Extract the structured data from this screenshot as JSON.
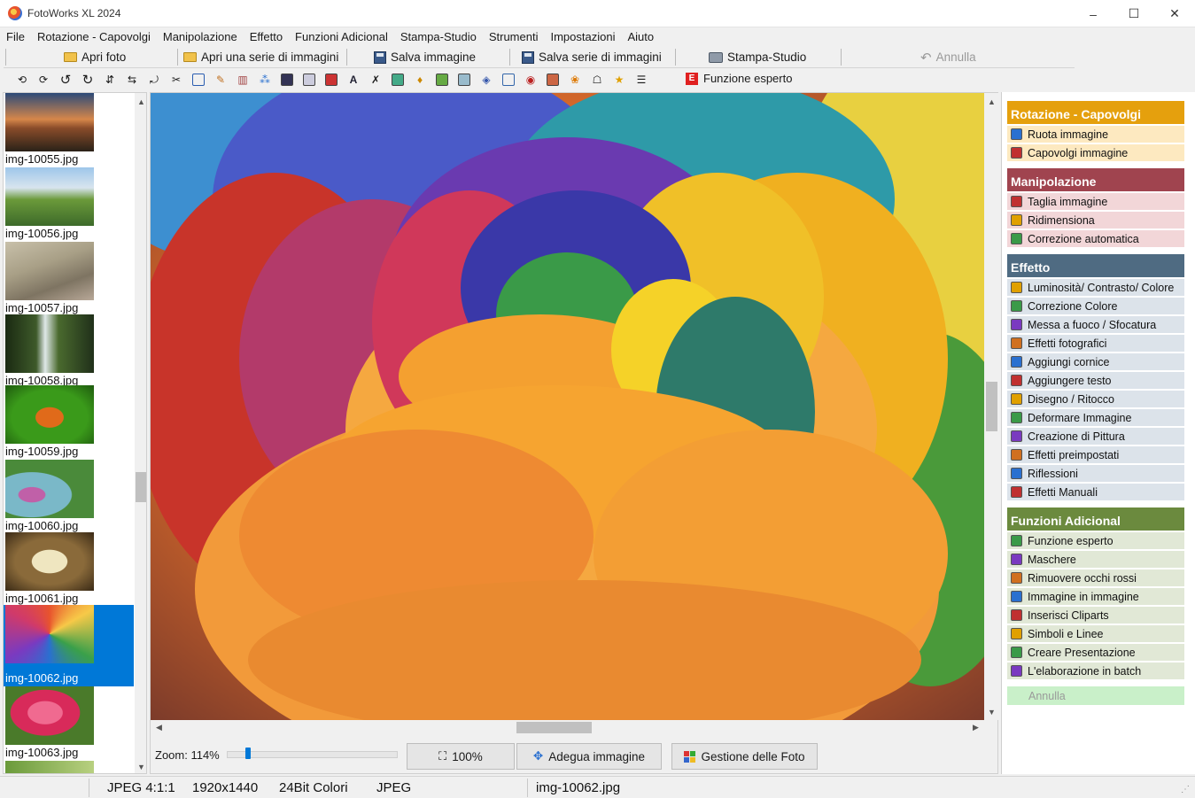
{
  "window": {
    "title": "FotoWorks XL 2024",
    "controls": [
      "–",
      "☐",
      "✕"
    ]
  },
  "menu": [
    "File",
    "Rotazione - Capovolgi",
    "Manipolazione",
    "Effetto",
    "Funzioni Adicional",
    "Stampa-Studio",
    "Strumenti",
    "Impostazioni",
    "Aiuto"
  ],
  "toolbar": {
    "open_photo": "Apri foto",
    "open_series": "Apri una serie di immagini",
    "save_image": "Salva immagine",
    "save_series": "Salva serie di immagini",
    "print_studio": "Stampa-Studio",
    "undo": "Annulla",
    "expert": "Funzione esperto",
    "expert_badge": "E"
  },
  "thumbnails": [
    {
      "name": "img-10055.jpg",
      "selected": false
    },
    {
      "name": "img-10056.jpg",
      "selected": false
    },
    {
      "name": "img-10057.jpg",
      "selected": false
    },
    {
      "name": "img-10058.jpg",
      "selected": false
    },
    {
      "name": "img-10059.jpg",
      "selected": false
    },
    {
      "name": "img-10060.jpg",
      "selected": false
    },
    {
      "name": "img-10061.jpg",
      "selected": false
    },
    {
      "name": "img-10062.jpg",
      "selected": true
    },
    {
      "name": "img-10063.jpg",
      "selected": false
    }
  ],
  "viewer": {
    "zoom_label": "Zoom: 114%",
    "zoom_slider_fraction": 0.11,
    "btn_100": "100%",
    "btn_fit": "Adegua immagine",
    "btn_manage": "Gestione delle Foto"
  },
  "panel": {
    "sections": [
      {
        "title": "Rotazione - Capovolgi",
        "color": "#e5a00d",
        "bg": "#fde9c0",
        "items": [
          "Ruota immagine",
          "Capovolgi immagine"
        ]
      },
      {
        "title": "Manipolazione",
        "color": "#a0444f",
        "bg": "#f2d6d8",
        "items": [
          "Taglia immagine",
          "Ridimensiona",
          "Correzione automatica"
        ]
      },
      {
        "title": "Effetto",
        "color": "#4f6b82",
        "bg": "#dce3ea",
        "items": [
          "Luminosità/ Contrasto/ Colore",
          "Correzione Colore",
          "Messa a fuoco / Sfocatura",
          "Effetti fotografici",
          "Aggiungi cornice",
          "Aggiungere testo",
          "Disegno / Ritocco",
          "Deformare Immagine",
          "Creazione di Pittura",
          "Effetti preimpostati",
          "Riflessioni",
          "Effetti Manuali"
        ]
      },
      {
        "title": "Funzioni Adicional",
        "color": "#6b8a3e",
        "bg": "#e1e8d6",
        "items": [
          "Funzione esperto",
          "Maschere",
          "Rimuovere occhi rossi",
          "Immagine in immagine",
          "Inserisci Cliparts",
          "Simboli e Linee",
          "Creare Presentazione",
          "L'elaborazione in batch"
        ]
      }
    ],
    "undo": "Annulla"
  },
  "status": {
    "format": "JPEG  4:1:1",
    "size": "1920x1440",
    "colors": "24Bit Colori",
    "type": "JPEG",
    "file": "img-10062.jpg"
  }
}
